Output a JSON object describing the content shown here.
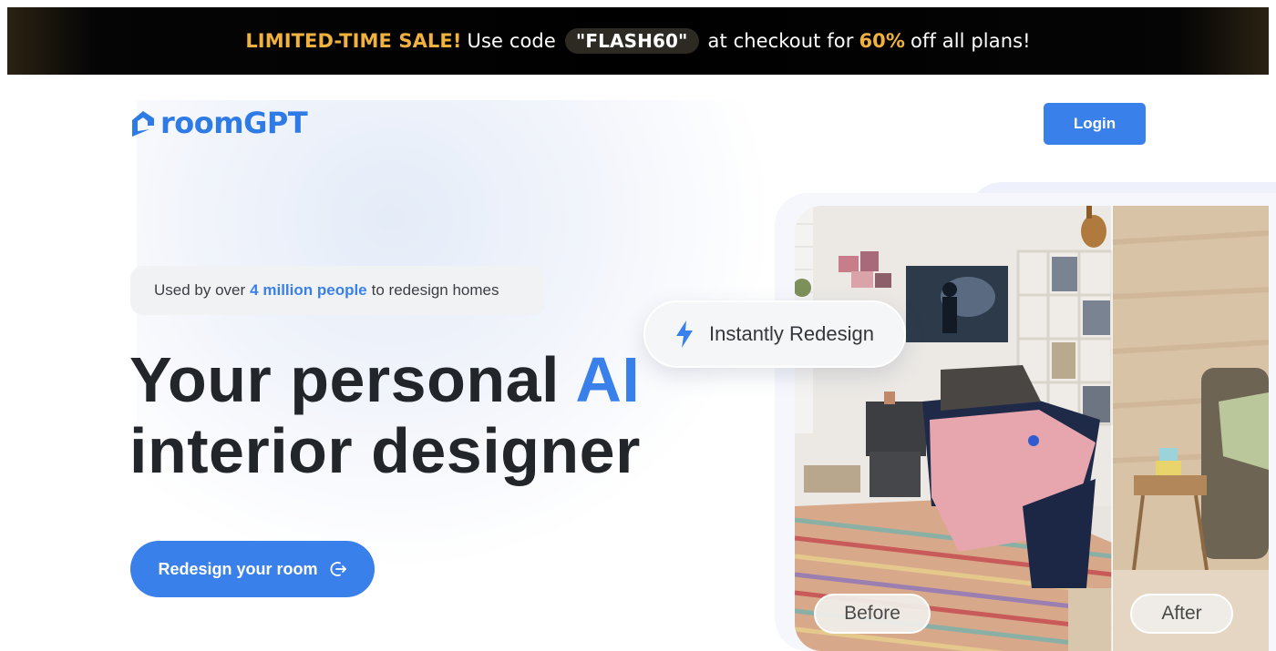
{
  "promo": {
    "sale_label": "LIMITED-TIME SALE!",
    "use_code": "Use code",
    "code": "\"FLASH60\"",
    "at_checkout": "at checkout for",
    "percent": "60%",
    "tail": "off all plans!"
  },
  "header": {
    "brand": "roomGPT",
    "login_label": "Login"
  },
  "hero": {
    "badge_prefix": "Used by over",
    "badge_highlight": "4 million people",
    "badge_suffix": "to redesign homes",
    "headline_part1": "Your personal",
    "headline_accent": "AI",
    "headline_part2": "interior designer",
    "cta_label": "Redesign your room"
  },
  "showcase": {
    "instant_label": "Instantly Redesign",
    "before_label": "Before",
    "after_label": "After"
  },
  "colors": {
    "accent": "#3a80ea",
    "sale_gold": "#f0b13f",
    "banner_bg": "#000000"
  },
  "icons": {
    "logo": "house-logo-icon",
    "cta": "arrow-enter-icon",
    "instant": "lightning-bolt-icon"
  }
}
